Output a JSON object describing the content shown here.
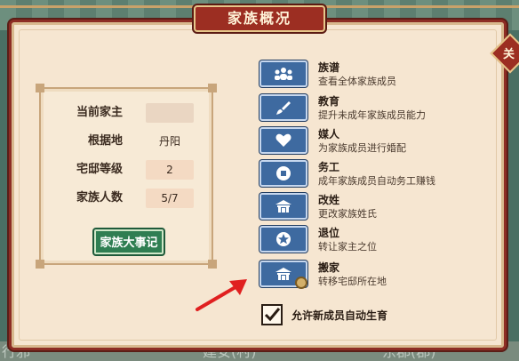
{
  "window": {
    "title": "家族概况",
    "close_label": "关"
  },
  "background": {
    "left_text": "行邪",
    "center_text": "建安(村)",
    "right_text": "东郡(郡)"
  },
  "info": {
    "rows": [
      {
        "label": "当前家主",
        "value": ""
      },
      {
        "label": "根据地",
        "value": "丹阳"
      },
      {
        "label": "宅邸等级",
        "value": "2"
      },
      {
        "label": "家族人数",
        "value": "5/7"
      }
    ],
    "history_button": "家族大事记"
  },
  "actions": [
    {
      "title": "族谱",
      "desc": "查看全体家族成员",
      "icon": "people-icon"
    },
    {
      "title": "教育",
      "desc": "提升未成年家族成员能力",
      "icon": "brush-icon"
    },
    {
      "title": "媒人",
      "desc": "为家族成员进行婚配",
      "icon": "heart-icon"
    },
    {
      "title": "务工",
      "desc": "成年家族成员自动务工赚钱",
      "icon": "coin-icon"
    },
    {
      "title": "改姓",
      "desc": "更改家族姓氏",
      "icon": "house-icon"
    },
    {
      "title": "退位",
      "desc": "转让家主之位",
      "icon": "star-icon"
    },
    {
      "title": "搬家",
      "desc": "转移宅邸所在地",
      "icon": "house-icon"
    }
  ],
  "checkbox": {
    "label": "允许新成员自动生育",
    "checked": true
  },
  "colors": {
    "frame": "#8d2d24",
    "action_button": "#3e6aa0",
    "history_button": "#2f7e52",
    "panel": "#f6e6d1"
  }
}
